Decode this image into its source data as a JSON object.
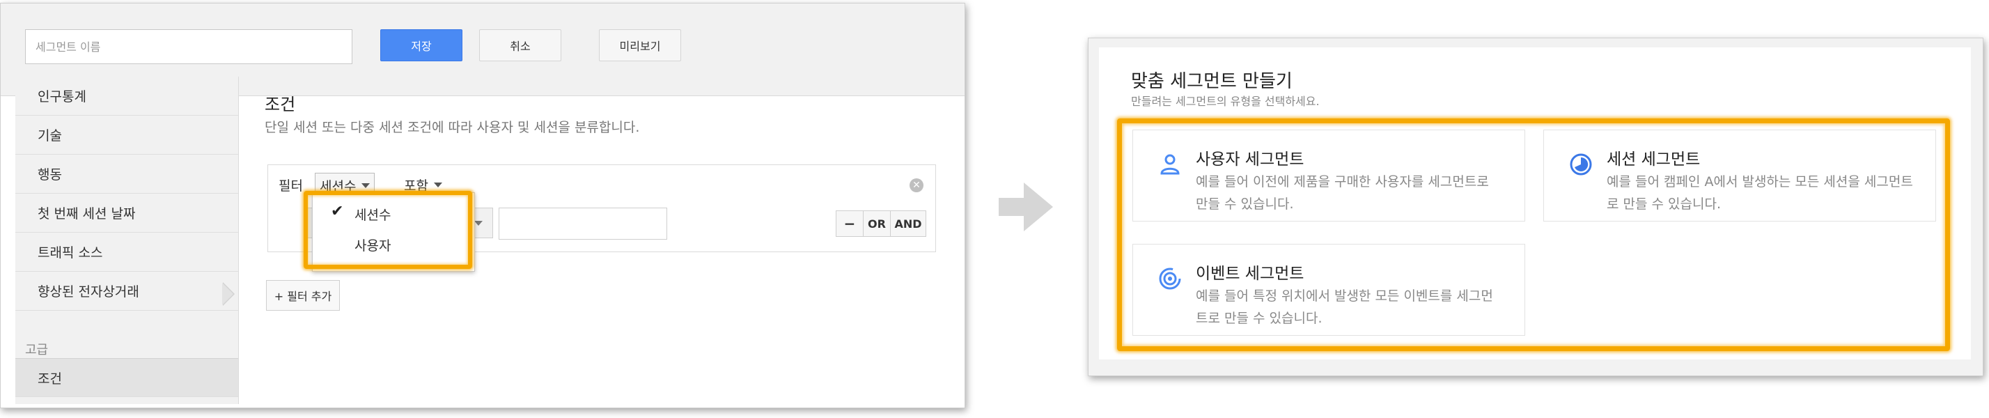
{
  "colors": {
    "accent_blue": "#4a8af4",
    "highlight_orange": "#f5a800",
    "sidebar_bg": "#f1f1f1"
  },
  "editor": {
    "name_placeholder": "세그먼트 이름",
    "save_label": "저장",
    "cancel_label": "취소",
    "preview_label": "미리보기"
  },
  "sidebar": {
    "items": [
      {
        "label": "인구통계"
      },
      {
        "label": "기술"
      },
      {
        "label": "행동"
      },
      {
        "label": "첫 번째 세션 날짜"
      },
      {
        "label": "트래픽 소스"
      },
      {
        "label": "향상된 전자상거래"
      }
    ],
    "section_label": "고급",
    "active_item": "조건"
  },
  "conditions": {
    "title": "조건",
    "description": "단일 세션 또는 다중 세션 조건에 따라 사용자 및 세션을 분류합니다.",
    "filter_label": "필터",
    "scope_selected": "세션수",
    "include_selected": "포함",
    "dropdown_options": [
      "세션수",
      "사용자"
    ],
    "remove_label": "−",
    "or_label": "OR",
    "and_label": "AND",
    "add_filter_label": "+ 필터 추가"
  },
  "custom_segment": {
    "title": "맞춤 세그먼트 만들기",
    "subtitle": "만들려는 세그먼트의 유형을 선택하세요.",
    "cards": [
      {
        "icon": "person-icon",
        "title": "사용자 세그먼트",
        "description": "예를 들어 이전에 제품을 구매한 사용자를 세그먼트로 만들 수 있습니다."
      },
      {
        "icon": "pie-icon",
        "title": "세션 세그먼트",
        "description": "예를 들어 캠페인 A에서 발생하는 모든 세션을 세그먼트로 만들 수 있습니다."
      },
      {
        "icon": "target-icon",
        "title": "이벤트 세그먼트",
        "description": "예를 들어 특정 위치에서 발생한 모든 이벤트를 세그먼트로 만들 수 있습니다."
      }
    ]
  }
}
